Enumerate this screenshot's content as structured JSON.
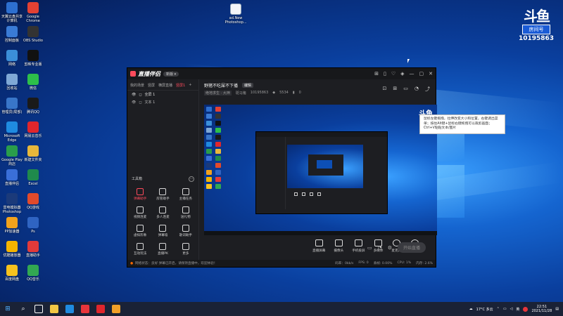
{
  "desktop": {
    "icons": [
      {
        "label": "天翼云盘共享\n计算机",
        "color": "#2d6fcf"
      },
      {
        "label": "Google\nChrome",
        "color": "#e34133"
      },
      {
        "label": "控制面板",
        "color": "#3a7bd5"
      },
      {
        "label": "OBS Studio",
        "color": "#333333"
      },
      {
        "label": "网络",
        "color": "#3b8fd9"
      },
      {
        "label": "剪映专业版",
        "color": "#111111"
      },
      {
        "label": "回收站",
        "color": "#7fa8d6"
      },
      {
        "label": "微信",
        "color": "#2dbf4a"
      },
      {
        "label": "管理员(局部)",
        "color": "#3976c9"
      },
      {
        "label": "腾讯QQ",
        "color": "#1a1a1a"
      },
      {
        "label": "Microsoft\nEdge",
        "color": "#1f8be0"
      },
      {
        "label": "网易云音乐",
        "color": "#e0262c"
      },
      {
        "label": "Google Play\n商店",
        "color": "#2a9d4b"
      },
      {
        "label": "新建文件夹",
        "color": "#e7b73b"
      },
      {
        "label": "直播伴侣",
        "color": "#3a6fd8"
      },
      {
        "label": "Excel",
        "color": "#1f8a4c"
      },
      {
        "label": "雷电模拟器\nPhotoshop",
        "color": "#1b3a7a"
      },
      {
        "label": "QQ游戏",
        "color": "#e14a2b"
      },
      {
        "label": "PP加速器",
        "color": "#f2a21c"
      },
      {
        "label": "Ps",
        "color": "#2f64c2"
      },
      {
        "label": "优酷播放器",
        "color": "#f4b400"
      },
      {
        "label": "直播助手",
        "color": "#e23a3a"
      },
      {
        "label": "百度网盘",
        "color": "#f7c21e"
      },
      {
        "label": "QQ音乐",
        "color": "#32a852"
      }
    ],
    "top_file": {
      "label": "ad.New\nPhotoshop...",
      "color": "#f3f5f8"
    }
  },
  "watermark": {
    "glyph": "斗鱼",
    "room_label": "房间号",
    "room_number": "10195863"
  },
  "app": {
    "brand": "直播伴侣",
    "version": "新版 ▾",
    "titlebar_icons": [
      "⊞",
      "▯",
      "♡",
      "◈",
      "—",
      "▢",
      "✕"
    ],
    "scene_tabs": [
      "我的场景",
      "竖屏",
      "横屏直播",
      "竖屏1",
      "+"
    ],
    "scene_items": [
      {
        "label": "全屏 1",
        "selected": true
      },
      {
        "label": "文本 1",
        "selected": false
      }
    ],
    "tools_title": "工具箱",
    "tools_more": "…",
    "tools": [
      {
        "label": "弹幕助手",
        "hot": true
      },
      {
        "label": "房管助手",
        "hot": false
      },
      {
        "label": "主播任务",
        "hot": false
      },
      {
        "label": "视频连麦",
        "hot": false
      },
      {
        "label": "多人连麦",
        "hot": false
      },
      {
        "label": "送礼物",
        "hot": false
      },
      {
        "label": "虚拟形象",
        "hot": false
      },
      {
        "label": "弹幕墙",
        "hot": false
      },
      {
        "label": "歌词助手",
        "hot": false
      },
      {
        "label": "互动玩法",
        "hot": false
      },
      {
        "label": "直播PK",
        "hot": false
      },
      {
        "label": "更多",
        "hot": false
      }
    ],
    "room": {
      "title": "野猪不吃屎不下播",
      "edit": "编辑",
      "category": "绝地求生 · 大神",
      "host": "斑马猪",
      "room_no": "10195863",
      "fans": "5534",
      "likes": "0"
    },
    "room_icons": [
      "⊡",
      "⊞",
      "▭",
      "◔",
      "⤴"
    ],
    "preview_watermark": "斗鱼",
    "tooltip": "鼠标左键拖拽，拉伸改变大小和位置，右键调出菜单；按住Alt键+鼠标右键拖拽可以裁剪画面；Ctrl+V粘贴文本/图片",
    "controls": [
      {
        "label": "直播屏幕"
      },
      {
        "label": "摄像头"
      },
      {
        "label": "手机投屏"
      },
      {
        "label": "多媒体"
      },
      {
        "label": "麦克风"
      },
      {
        "label": "扬声器"
      }
    ],
    "right_controls": [
      "▭",
      "◔",
      "⚙"
    ],
    "go_live": "开始直播",
    "status_left": "网络状态：良好   弹幕已开启，请保持直播中，欢迎体验！",
    "stats": [
      "码率：0kb/s",
      "FPS: 0",
      "丢帧: 0.00%",
      "CPU: 1%",
      "内存: 2.6%"
    ]
  },
  "taskbar": {
    "start_icon": "⊞",
    "search_icon": "⌕",
    "apps": [
      {
        "name": "task-view",
        "color": "#ffffff"
      },
      {
        "name": "file-explorer",
        "color": "#f2c744"
      },
      {
        "name": "edge",
        "color": "#1f8be0"
      },
      {
        "name": "douyu-assistant",
        "color": "#e8353b"
      },
      {
        "name": "netease-music",
        "color": "#e0262c"
      },
      {
        "name": "live-companion",
        "color": "#f0a028"
      }
    ],
    "weather": "17°C  多云",
    "language": "英",
    "time": "22:51",
    "date": "2021/11/28"
  }
}
